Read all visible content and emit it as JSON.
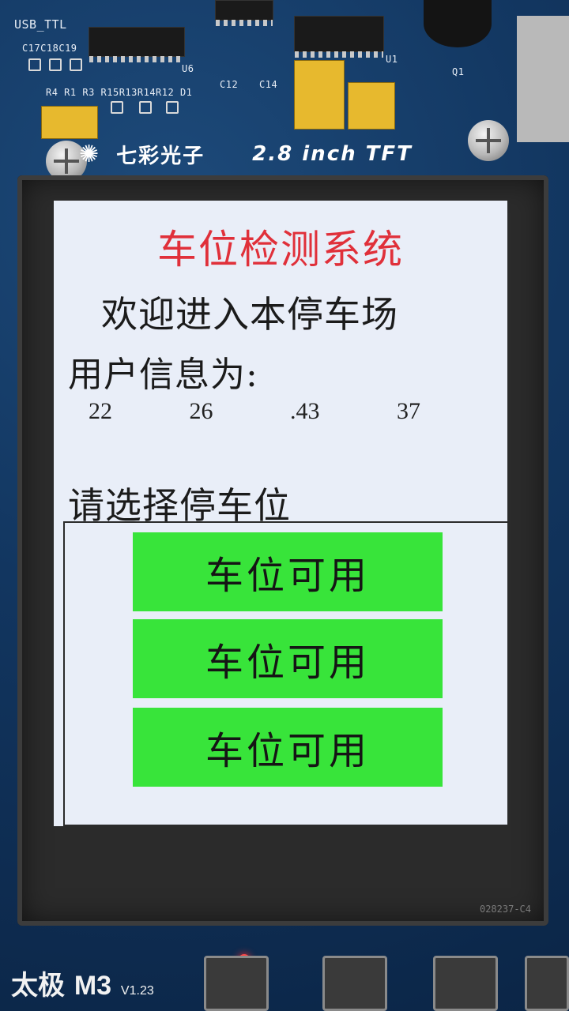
{
  "board": {
    "silk_usb": "USB_TTL",
    "silk_caps": "C17C18C19",
    "silk_u6": "U6",
    "silk_resistors": "R4 R1 R3 R15R13R14R12 D1",
    "silk_c12": "C12",
    "silk_c14": "C14",
    "silk_u1": "U1",
    "silk_q1": "Q1",
    "brand_cn": "七彩光子",
    "brand_en": "2.8 inch TFT",
    "frame_code": "028237-C4",
    "bottom_brand": "太极",
    "bottom_model": "M3",
    "bottom_version": "V1.23"
  },
  "screen": {
    "title": "车位检测系统",
    "welcome": "欢迎进入本停车场",
    "user_info_label": "用户信息为:",
    "user_values": [
      "22",
      "26",
      ".43",
      "37"
    ],
    "select_label": "请选择停车位",
    "slots": [
      {
        "label": "车位可用",
        "status": "available"
      },
      {
        "label": "车位可用",
        "status": "available"
      },
      {
        "label": "车位可用",
        "status": "available"
      }
    ]
  },
  "colors": {
    "title": "#e0303a",
    "slot_available": "#38e43a",
    "screen_bg": "#e9eef8"
  }
}
